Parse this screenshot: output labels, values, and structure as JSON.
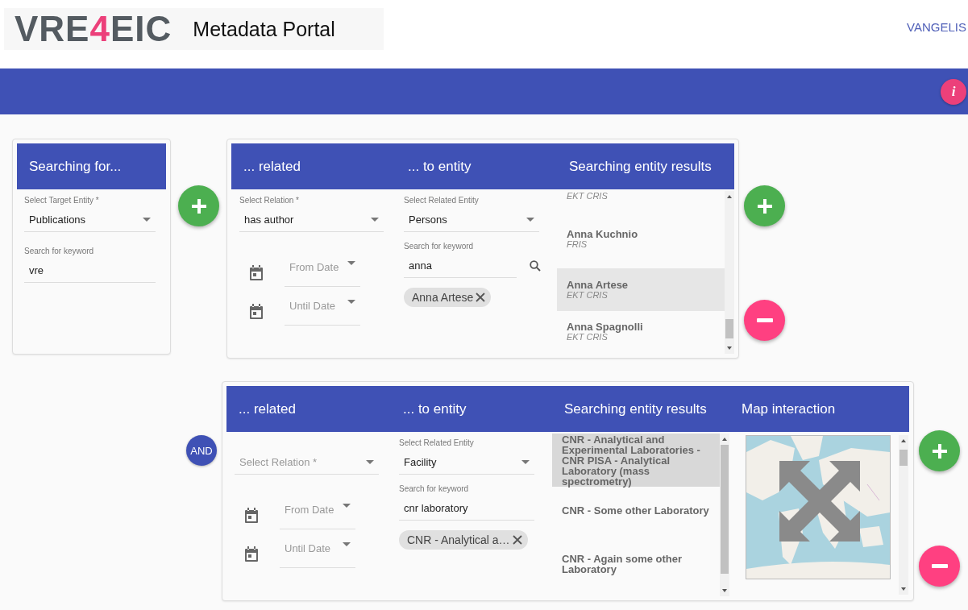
{
  "header": {
    "logo": [
      {
        "text": "VRE",
        "color": "#545b61"
      },
      {
        "text": "4",
        "color": "#ec407a"
      },
      {
        "text": "EIC",
        "color": "#545b61"
      }
    ],
    "title": "Metadata Portal",
    "user": "VANGELIS"
  },
  "toolbar": {
    "info_button": "i"
  },
  "target": {
    "title": "Searching for...",
    "entity_field": {
      "label": "Select Target Entity *",
      "value": "Publications"
    },
    "keyword_field": {
      "label": "Search for keyword",
      "value": "vre"
    }
  },
  "relations": [
    {
      "headers": [
        "... related",
        "... to entity",
        "Searching entity results"
      ],
      "relation_field": {
        "label": "Select Relation *",
        "value": "has author"
      },
      "dates": [
        {
          "placeholder": "From Date"
        },
        {
          "placeholder": "Until Date"
        }
      ],
      "entity_field": {
        "label": "Select Related Entity",
        "value": "Persons"
      },
      "keyword_field": {
        "label": "Search for keyword",
        "value": "anna",
        "search_button": true
      },
      "chips": [
        "Anna Artese"
      ],
      "kind": "person",
      "results": [
        {
          "source": "EKT CRIS",
          "selected": false
        },
        {
          "name": "Anna Kuchnio",
          "source": "FRIS",
          "selected": false
        },
        {
          "name": "Anna Artese",
          "source": "EKT CRIS",
          "selected": true
        },
        {
          "name": "Anna Spagnolli",
          "source": "EKT CRIS",
          "selected": false
        }
      ]
    },
    {
      "connector": "AND",
      "headers": [
        "... related",
        "... to entity",
        "Searching entity results",
        "Map interaction"
      ],
      "relation_field": {
        "placeholder": "Select Relation *"
      },
      "dates": [
        {
          "placeholder": "From Date"
        },
        {
          "placeholder": "Until Date"
        }
      ],
      "entity_field": {
        "label": "Select Related Entity",
        "value": "Facility"
      },
      "keyword_field": {
        "label": "Search for keyword",
        "value": "cnr laboratory",
        "search_button": false
      },
      "chips": [
        "CNR - Analytical a…"
      ],
      "kind": "facility",
      "results": [
        {
          "name": "CNR - Analytical and Experimental Laboratories - CNR PISA - Analytical Laboratory (mass spectrometry)",
          "selected": true
        },
        {
          "name": "CNR - Some other Laboratory",
          "selected": false
        },
        {
          "name": "CNR - Again some other Laboratory",
          "selected": false
        }
      ],
      "map": {
        "kind": "picture"
      }
    }
  ]
}
